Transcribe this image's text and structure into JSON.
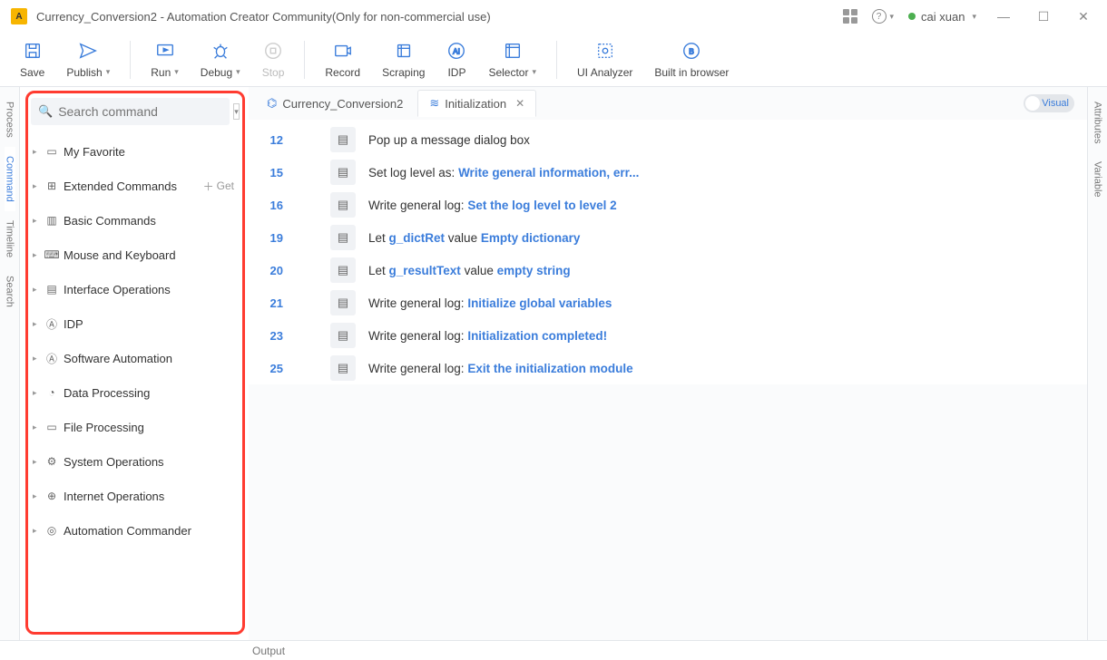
{
  "title": "Currency_Conversion2 - Automation Creator Community(Only for non-commercial use)",
  "user": "cai xuan",
  "toolbar": {
    "save": "Save",
    "publish": "Publish",
    "run": "Run",
    "debug": "Debug",
    "stop": "Stop",
    "record": "Record",
    "scraping": "Scraping",
    "idp": "IDP",
    "selector": "Selector",
    "uianalyzer": "UI Analyzer",
    "browser": "Built in browser"
  },
  "leftRail": [
    "Process",
    "Command",
    "Timeline",
    "Search"
  ],
  "rightRail": [
    "Attributes",
    "Variable"
  ],
  "search": {
    "placeholder": "Search command"
  },
  "sidebar": {
    "items": [
      {
        "label": "My Favorite",
        "icon": "folder"
      },
      {
        "label": "Extended Commands",
        "icon": "ext",
        "get": "Get"
      },
      {
        "label": "Basic Commands",
        "icon": "basic"
      },
      {
        "label": "Mouse and Keyboard",
        "icon": "mk"
      },
      {
        "label": "Interface Operations",
        "icon": "ui"
      },
      {
        "label": "IDP",
        "icon": "idp"
      },
      {
        "label": "Software Automation",
        "icon": "sw"
      },
      {
        "label": "Data Processing",
        "icon": "data"
      },
      {
        "label": "File Processing",
        "icon": "file"
      },
      {
        "label": "System Operations",
        "icon": "sys"
      },
      {
        "label": "Internet Operations",
        "icon": "net"
      },
      {
        "label": "Automation Commander",
        "icon": "cmd"
      }
    ]
  },
  "tabs": [
    {
      "label": "Currency_Conversion2",
      "icon": "flow"
    },
    {
      "label": "Initialization",
      "icon": "stack",
      "active": true,
      "closeable": true
    }
  ],
  "visualLabel": "Visual",
  "code": [
    {
      "n": "12",
      "pre": "Pop up a message dialog box",
      "kw": ""
    },
    {
      "n": "15",
      "pre": "Set log level as: ",
      "kw": "Write general information, err..."
    },
    {
      "n": "16",
      "pre": "Write general log: ",
      "kw": "Set the log level to level 2"
    },
    {
      "n": "19",
      "pre": "Let ",
      "kw": "g_dictRet",
      "mid": " value ",
      "kw2": "Empty dictionary"
    },
    {
      "n": "20",
      "pre": "Let ",
      "kw": "g_resultText",
      "mid": " value ",
      "kw2": "empty string"
    },
    {
      "n": "21",
      "pre": "Write general log: ",
      "kw": "Initialize global variables"
    },
    {
      "n": "23",
      "pre": "Write general log: ",
      "kw": "Initialization completed!"
    },
    {
      "n": "25",
      "pre": "Write general log: ",
      "kw": "Exit the initialization module"
    }
  ],
  "output": "Output"
}
